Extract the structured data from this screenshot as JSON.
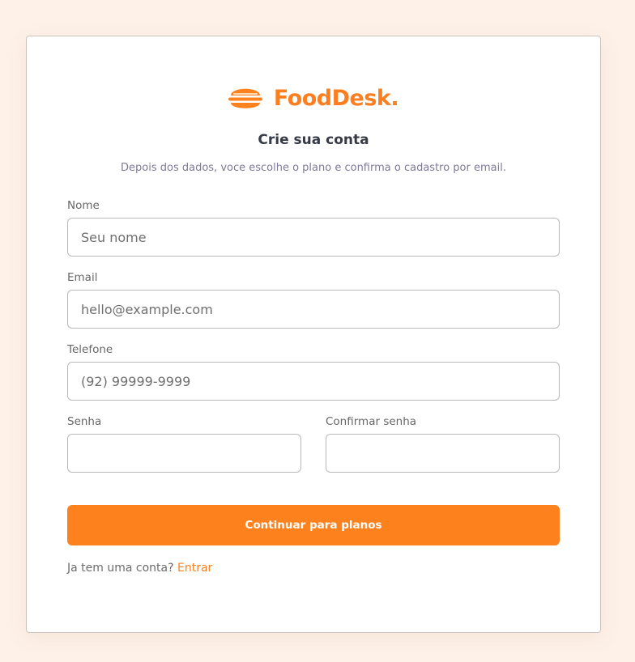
{
  "brand": {
    "name": "FoodDesk.",
    "accent_color": "#fd7e1f",
    "icon": "burger-icon"
  },
  "header": {
    "title": "Crie sua conta",
    "subtitle": "Depois dos dados, voce escolhe o plano e confirma o cadastro por email."
  },
  "form": {
    "name": {
      "label": "Nome",
      "placeholder": "Seu nome",
      "value": ""
    },
    "email": {
      "label": "Email",
      "placeholder": "hello@example.com",
      "value": ""
    },
    "phone": {
      "label": "Telefone",
      "placeholder": "(92) 99999-9999",
      "value": ""
    },
    "password": {
      "label": "Senha",
      "placeholder": "",
      "value": ""
    },
    "confirm_password": {
      "label": "Confirmar senha",
      "placeholder": "",
      "value": ""
    },
    "submit_label": "Continuar para planos"
  },
  "footer": {
    "prompt": "Ja tem uma conta?",
    "link_label": "Entrar"
  },
  "colors": {
    "background": "#fdf1e8",
    "button": "#fd821d",
    "text": "#363a45"
  }
}
